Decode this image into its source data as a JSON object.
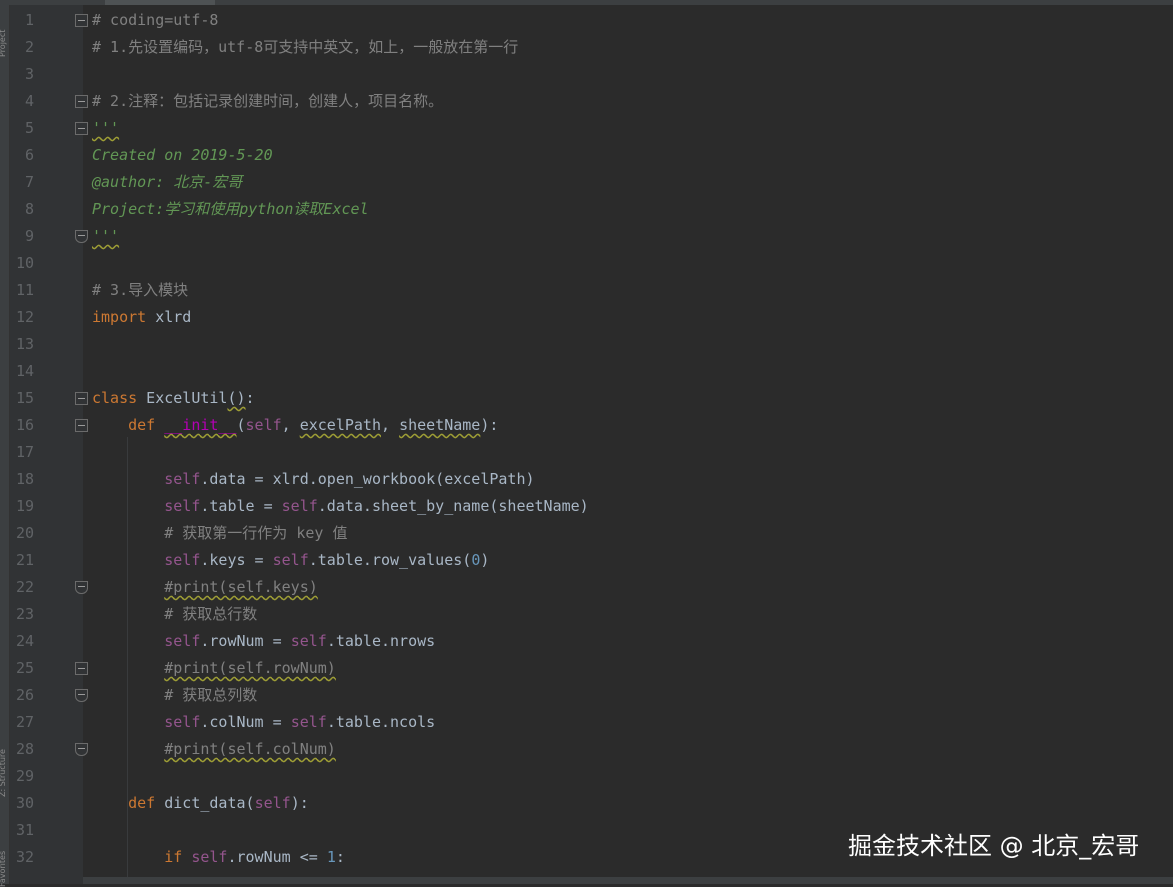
{
  "side_panels": {
    "top_label": "Project",
    "structure_label": "Z: Structure",
    "favorites_label": "Favorites"
  },
  "watermark": "掘金技术社区 @ 北京_宏哥",
  "lines": [
    {
      "n": "1",
      "tokens": [
        {
          "t": "# coding=utf-8",
          "c": "cm"
        }
      ]
    },
    {
      "n": "2",
      "tokens": [
        {
          "t": "# 1.先设置编码，utf-8可支持中英文，如上，一般放在第一行",
          "c": "cm"
        }
      ]
    },
    {
      "n": "3",
      "tokens": []
    },
    {
      "n": "4",
      "tokens": [
        {
          "t": "# 2.注释：包括记录创建时间，创建人，项目名称。",
          "c": "cm"
        }
      ]
    },
    {
      "n": "5",
      "tokens": [
        {
          "t": "'''",
          "c": "doc sq"
        }
      ]
    },
    {
      "n": "6",
      "tokens": [
        {
          "t": "Created on 2019-5-20",
          "c": "doc"
        }
      ]
    },
    {
      "n": "7",
      "tokens": [
        {
          "t": "@author: 北京-宏哥",
          "c": "doc"
        }
      ]
    },
    {
      "n": "8",
      "tokens": [
        {
          "t": "Project:学习和使用python读取Excel",
          "c": "doc"
        }
      ]
    },
    {
      "n": "9",
      "tokens": [
        {
          "t": "'''",
          "c": "doc sq"
        }
      ]
    },
    {
      "n": "10",
      "tokens": []
    },
    {
      "n": "11",
      "tokens": [
        {
          "t": "# 3.导入模块",
          "c": "cm"
        }
      ]
    },
    {
      "n": "12",
      "tokens": [
        {
          "t": "import",
          "c": "kw"
        },
        {
          "t": " xlrd"
        }
      ]
    },
    {
      "n": "13",
      "tokens": []
    },
    {
      "n": "14",
      "tokens": []
    },
    {
      "n": "15",
      "tokens": [
        {
          "t": "class",
          "c": "kw"
        },
        {
          "t": " ExcelUtil"
        },
        {
          "t": "()",
          "c": "sq"
        },
        {
          "t": ":"
        }
      ]
    },
    {
      "n": "16",
      "tokens": [
        {
          "t": "    "
        },
        {
          "t": "def",
          "c": "kw"
        },
        {
          "t": " "
        },
        {
          "t": "__init__",
          "c": "magic sq"
        },
        {
          "t": "("
        },
        {
          "t": "self",
          "c": "self"
        },
        {
          "t": ", "
        },
        {
          "t": "excelPath",
          "c": "sq"
        },
        {
          "t": ", "
        },
        {
          "t": "sheetName",
          "c": "sq"
        },
        {
          "t": "):"
        }
      ]
    },
    {
      "n": "17",
      "tokens": []
    },
    {
      "n": "18",
      "tokens": [
        {
          "t": "        "
        },
        {
          "t": "self",
          "c": "self"
        },
        {
          "t": ".data = xlrd.open_workbook(excelPath)"
        }
      ]
    },
    {
      "n": "19",
      "tokens": [
        {
          "t": "        "
        },
        {
          "t": "self",
          "c": "self"
        },
        {
          "t": ".table = "
        },
        {
          "t": "self",
          "c": "self"
        },
        {
          "t": ".data.sheet_by_name(sheetName)"
        }
      ]
    },
    {
      "n": "20",
      "tokens": [
        {
          "t": "        "
        },
        {
          "t": "# 获取第一行作为 key 值",
          "c": "cm"
        }
      ]
    },
    {
      "n": "21",
      "tokens": [
        {
          "t": "        "
        },
        {
          "t": "self",
          "c": "self"
        },
        {
          "t": ".keys = "
        },
        {
          "t": "self",
          "c": "self"
        },
        {
          "t": ".table.row_values("
        },
        {
          "t": "0",
          "c": "num"
        },
        {
          "t": ")"
        }
      ]
    },
    {
      "n": "22",
      "tokens": [
        {
          "t": "        "
        },
        {
          "t": "#print(self.keys)",
          "c": "cm sq"
        }
      ]
    },
    {
      "n": "23",
      "tokens": [
        {
          "t": "        "
        },
        {
          "t": "# 获取总行数",
          "c": "cm"
        }
      ]
    },
    {
      "n": "24",
      "tokens": [
        {
          "t": "        "
        },
        {
          "t": "self",
          "c": "self"
        },
        {
          "t": ".rowNum = "
        },
        {
          "t": "self",
          "c": "self"
        },
        {
          "t": ".table.nrows"
        }
      ]
    },
    {
      "n": "25",
      "tokens": [
        {
          "t": "        "
        },
        {
          "t": "#print(self.rowNum)",
          "c": "cm sq"
        }
      ]
    },
    {
      "n": "26",
      "tokens": [
        {
          "t": "        "
        },
        {
          "t": "# 获取总列数",
          "c": "cm"
        }
      ]
    },
    {
      "n": "27",
      "tokens": [
        {
          "t": "        "
        },
        {
          "t": "self",
          "c": "self"
        },
        {
          "t": ".colNum = "
        },
        {
          "t": "self",
          "c": "self"
        },
        {
          "t": ".table.ncols"
        }
      ]
    },
    {
      "n": "28",
      "tokens": [
        {
          "t": "        "
        },
        {
          "t": "#print(self.colNum)",
          "c": "cm sq"
        }
      ]
    },
    {
      "n": "29",
      "tokens": []
    },
    {
      "n": "30",
      "tokens": [
        {
          "t": "    "
        },
        {
          "t": "def",
          "c": "kw"
        },
        {
          "t": " "
        },
        {
          "t": "dict_data"
        },
        {
          "t": "("
        },
        {
          "t": "self",
          "c": "self"
        },
        {
          "t": "):"
        }
      ]
    },
    {
      "n": "31",
      "tokens": []
    },
    {
      "n": "32",
      "tokens": [
        {
          "t": "        "
        },
        {
          "t": "if",
          "c": "kw"
        },
        {
          "t": " "
        },
        {
          "t": "self",
          "c": "self"
        },
        {
          "t": ".rowNum <= "
        },
        {
          "t": "1",
          "c": "num"
        },
        {
          "t": ":"
        }
      ]
    }
  ],
  "folds": {
    "1": "open",
    "4": "open",
    "5": "open",
    "9": "close",
    "15": "open",
    "16": "open",
    "22": "close",
    "25": "open",
    "26": "close",
    "28": "close"
  }
}
